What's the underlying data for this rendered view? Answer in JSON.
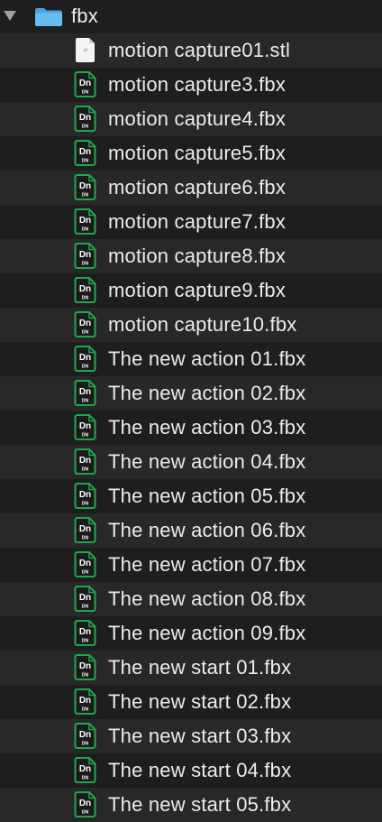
{
  "folder": {
    "name": "fbx",
    "icon": "folder-icon",
    "expanded": true
  },
  "files": [
    {
      "name": "motion capture01.stl",
      "icon": "generic-file-icon"
    },
    {
      "name": "motion capture3.fbx",
      "icon": "dn-file-icon",
      "badge_top": "Dn",
      "badge_bottom": "DN"
    },
    {
      "name": "motion capture4.fbx",
      "icon": "dn-file-icon",
      "badge_top": "Dn",
      "badge_bottom": "DN"
    },
    {
      "name": "motion capture5.fbx",
      "icon": "dn-file-icon",
      "badge_top": "Dn",
      "badge_bottom": "DN"
    },
    {
      "name": "motion capture6.fbx",
      "icon": "dn-file-icon",
      "badge_top": "Dn",
      "badge_bottom": "DN"
    },
    {
      "name": "motion capture7.fbx",
      "icon": "dn-file-icon",
      "badge_top": "Dn",
      "badge_bottom": "DN"
    },
    {
      "name": "motion capture8.fbx",
      "icon": "dn-file-icon",
      "badge_top": "Dn",
      "badge_bottom": "DN"
    },
    {
      "name": "motion capture9.fbx",
      "icon": "dn-file-icon",
      "badge_top": "Dn",
      "badge_bottom": "DN"
    },
    {
      "name": "motion capture10.fbx",
      "icon": "dn-file-icon",
      "badge_top": "Dn",
      "badge_bottom": "DN"
    },
    {
      "name": "The new action 01.fbx",
      "icon": "dn-file-icon",
      "badge_top": "Dn",
      "badge_bottom": "DN"
    },
    {
      "name": "The new action 02.fbx",
      "icon": "dn-file-icon",
      "badge_top": "Dn",
      "badge_bottom": "DN"
    },
    {
      "name": "The new action 03.fbx",
      "icon": "dn-file-icon",
      "badge_top": "Dn",
      "badge_bottom": "DN"
    },
    {
      "name": "The new action 04.fbx",
      "icon": "dn-file-icon",
      "badge_top": "Dn",
      "badge_bottom": "DN"
    },
    {
      "name": "The new action 05.fbx",
      "icon": "dn-file-icon",
      "badge_top": "Dn",
      "badge_bottom": "DN"
    },
    {
      "name": "The new action 06.fbx",
      "icon": "dn-file-icon",
      "badge_top": "Dn",
      "badge_bottom": "DN"
    },
    {
      "name": "The new action 07.fbx",
      "icon": "dn-file-icon",
      "badge_top": "Dn",
      "badge_bottom": "DN"
    },
    {
      "name": "The new action 08.fbx",
      "icon": "dn-file-icon",
      "badge_top": "Dn",
      "badge_bottom": "DN"
    },
    {
      "name": "The new action 09.fbx",
      "icon": "dn-file-icon",
      "badge_top": "Dn",
      "badge_bottom": "DN"
    },
    {
      "name": "The new start 01.fbx",
      "icon": "dn-file-icon",
      "badge_top": "Dn",
      "badge_bottom": "DN"
    },
    {
      "name": "The new start 02.fbx",
      "icon": "dn-file-icon",
      "badge_top": "Dn",
      "badge_bottom": "DN"
    },
    {
      "name": "The new start 03.fbx",
      "icon": "dn-file-icon",
      "badge_top": "Dn",
      "badge_bottom": "DN"
    },
    {
      "name": "The new start 04.fbx",
      "icon": "dn-file-icon",
      "badge_top": "Dn",
      "badge_bottom": "DN"
    },
    {
      "name": "The new start 05.fbx",
      "icon": "dn-file-icon",
      "badge_top": "Dn",
      "badge_bottom": "DN"
    }
  ],
  "colors": {
    "background": "#1e1e1e",
    "row_alt": "#282828",
    "text": "#ececec",
    "folder_blue": "#5fb4e8",
    "dn_green": "#1fa84a"
  }
}
